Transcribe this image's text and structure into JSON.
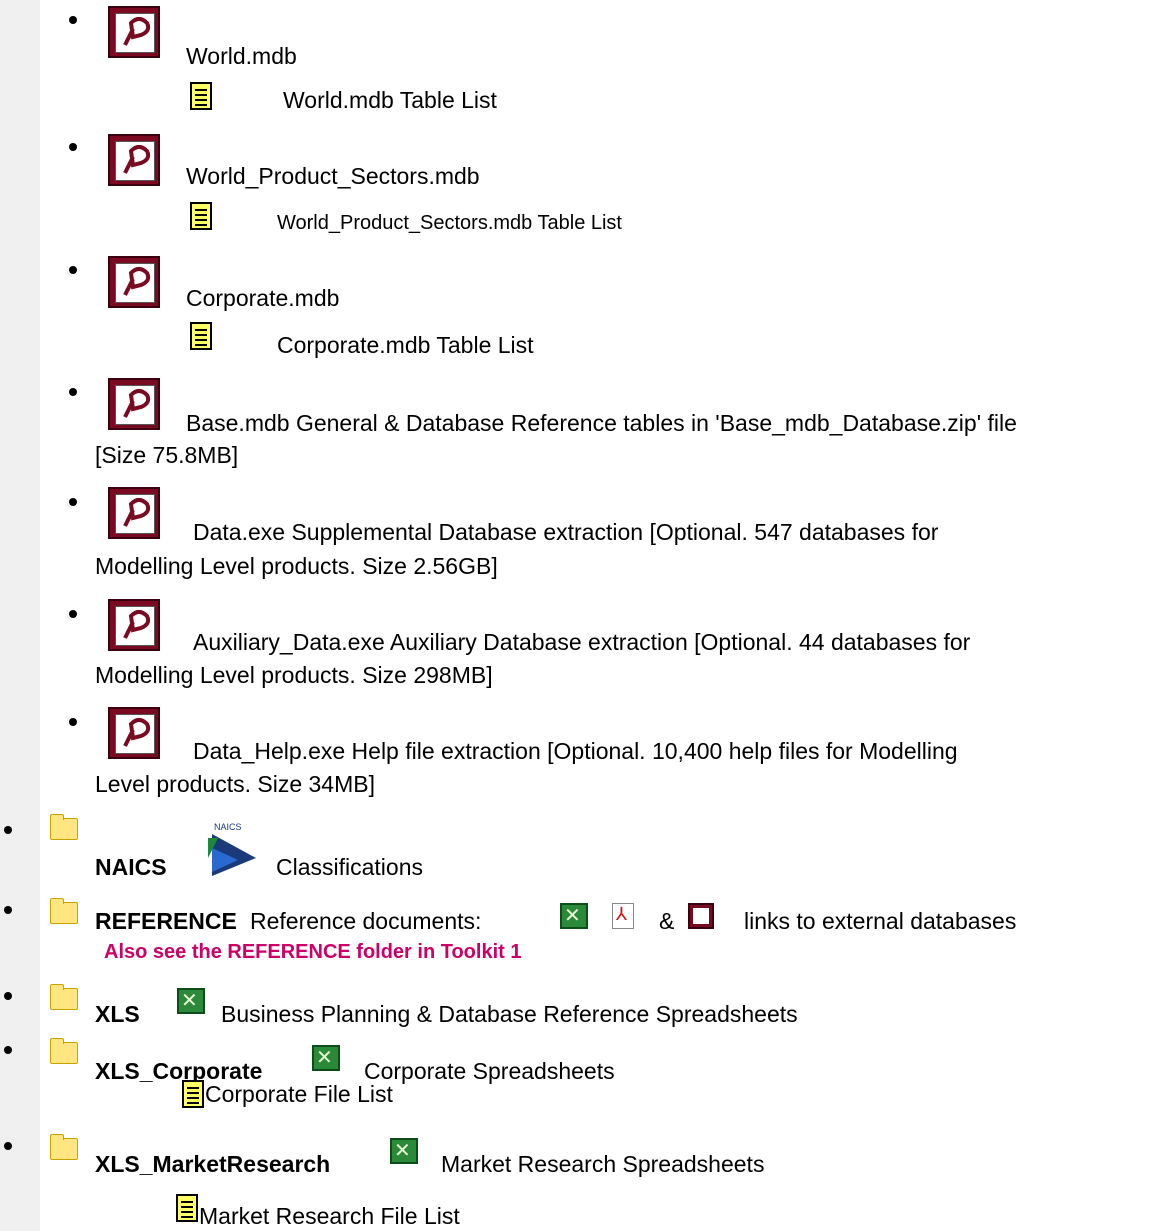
{
  "items": {
    "world": {
      "name": "World.mdb",
      "list": "World.mdb Table List"
    },
    "world_ps": {
      "name": "World_Product_Sectors.mdb",
      "list": "World_Product_Sectors.mdb Table List"
    },
    "corporate": {
      "name": "Corporate.mdb",
      "list": "Corporate.mdb Table List"
    },
    "base": {
      "line1": "Base.mdb   General & Database Reference tables in 'Base_mdb_Database.zip' file",
      "line2": "[Size 75.8MB]"
    },
    "data": {
      "line1": "Data.exe   Supplemental Database extraction [Optional. 547 databases for",
      "line2": "Modelling Level products. Size 2.56GB]"
    },
    "aux": {
      "line1": "Auxiliary_Data.exe   Auxiliary Database extraction [Optional. 44 databases for",
      "line2": "Modelling Level products. Size 298MB]"
    },
    "help": {
      "line1": "Data_Help.exe   Help file extraction [Optional. 10,400 help files for Modelling",
      "line2": "Level products. Size 34MB]"
    }
  },
  "folders": {
    "naics": {
      "name": "NAICS",
      "desc": "Classifications",
      "logo_text": "NAICS"
    },
    "reference": {
      "name": "REFERENCE",
      "desc1": "Reference documents:",
      "amp": "&",
      "desc2": "links to external databases",
      "note": "Also see the REFERENCE folder in Toolkit 1"
    },
    "xls": {
      "name": "XLS",
      "desc": "Business Planning & Database Reference Spreadsheets"
    },
    "xls_corp": {
      "name": "XLS_Corporate",
      "desc": "Corporate Spreadsheets",
      "list": "Corporate File List"
    },
    "xls_mr": {
      "name": "XLS_MarketResearch",
      "desc": "Market Research Spreadsheets",
      "list": "Market Research File List"
    }
  }
}
